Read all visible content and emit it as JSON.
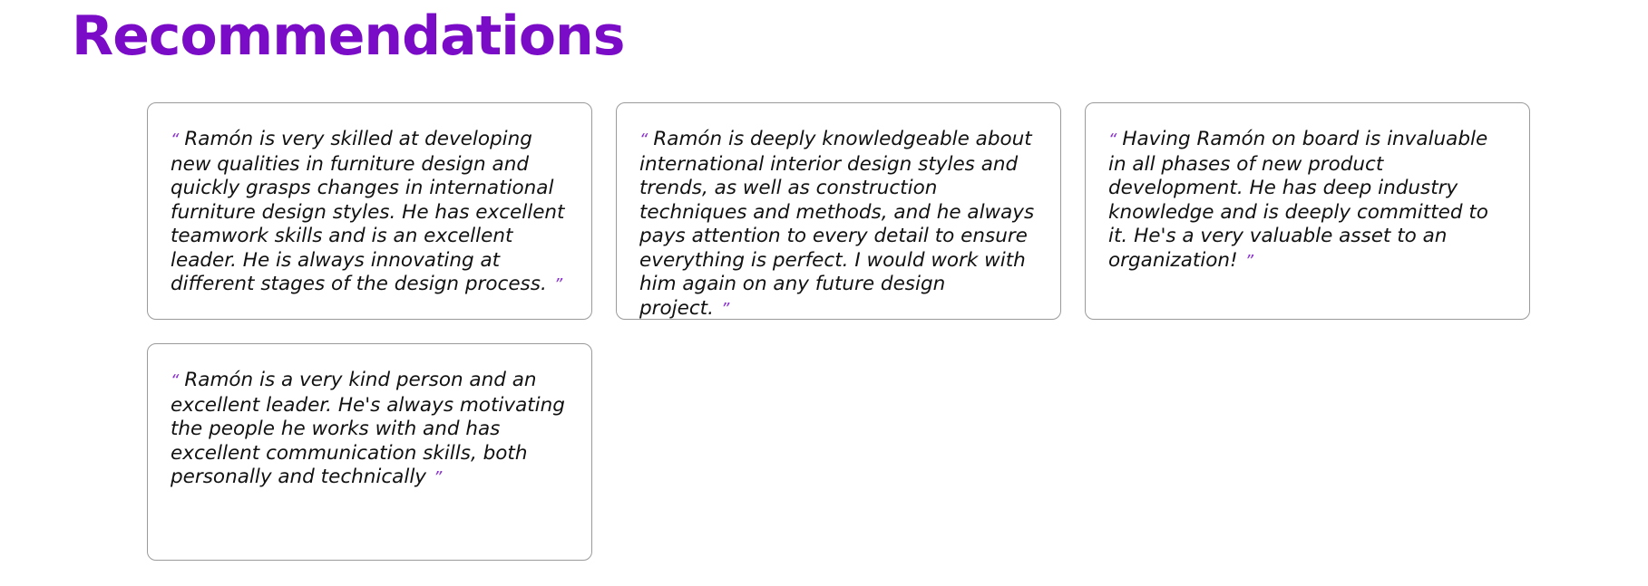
{
  "section": {
    "title": "Recommendations"
  },
  "quote_marks": {
    "open": "“",
    "close": "”"
  },
  "colors": {
    "title": "#7a0cc8",
    "quote_mark": "#8a2fd0",
    "card_border": "#9a9a9a",
    "text": "#111111"
  },
  "recommendations": [
    {
      "text": "Ramón is very skilled at developing new qualities in furniture design and quickly grasps changes in international furniture design styles. He has excellent teamwork skills and is an excellent leader. He is always innovating at different stages of the design process."
    },
    {
      "text": "Ramón is deeply knowledgeable about international interior design styles and trends, as well as construction techniques and methods, and he always pays attention to every detail to ensure everything is perfect. I would work with him again on any future design project."
    },
    {
      "text": "Having Ramón on board is invaluable in all phases of new product development. He has deep industry knowledge and is deeply committed to it. He's a very valuable asset to an organization!"
    },
    {
      "text": "Ramón is a very kind person and an excellent leader. He's always motivating the people he works with and has excellent communication skills, both personally and technically"
    }
  ]
}
